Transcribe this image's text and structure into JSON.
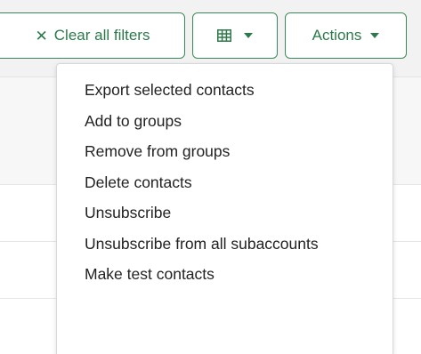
{
  "toolbar": {
    "clear_filters_label": "Clear all filters",
    "clear_icon": "close-icon",
    "columns_icon": "grid-icon",
    "actions_label": "Actions",
    "accent_color": "#2c7a4b"
  },
  "actions_menu": {
    "items": [
      {
        "label": "Export selected contacts"
      },
      {
        "label": "Add to groups"
      },
      {
        "label": "Remove from groups"
      },
      {
        "label": "Delete contacts"
      },
      {
        "label": "Unsubscribe"
      },
      {
        "label": "Unsubscribe from all subaccounts"
      },
      {
        "label": "Make test contacts"
      }
    ]
  }
}
